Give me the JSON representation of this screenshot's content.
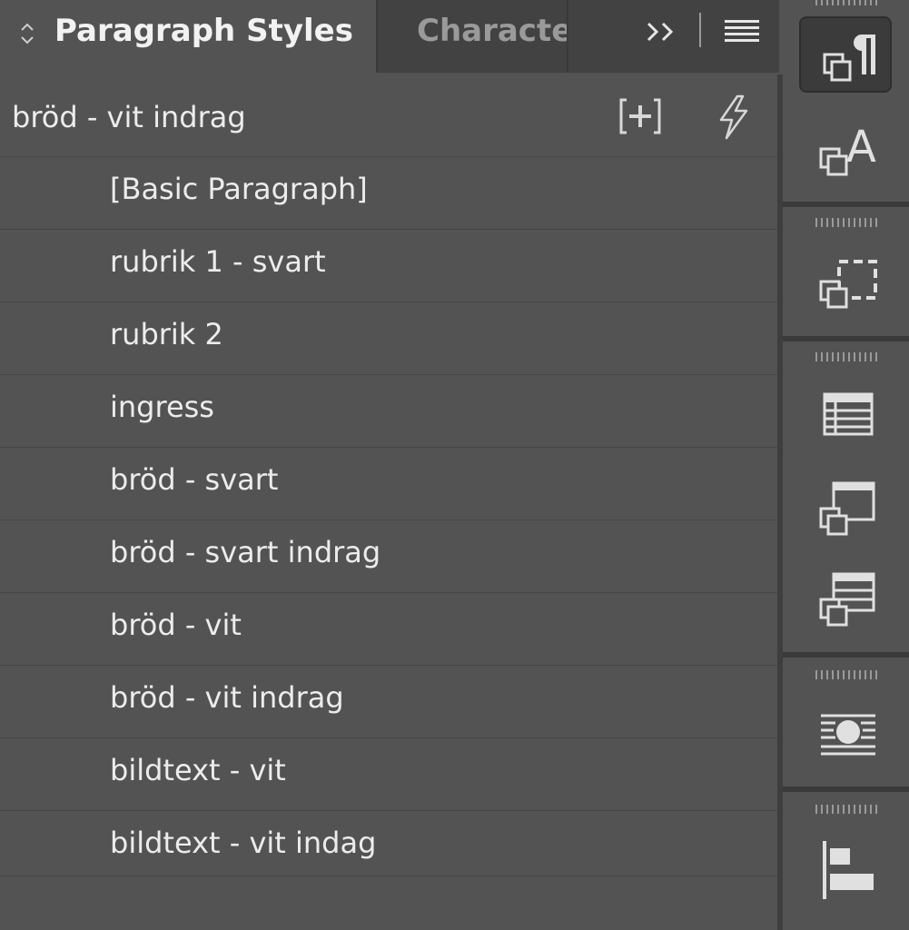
{
  "panel": {
    "tabs": [
      {
        "label": "Paragraph Styles",
        "active": true
      },
      {
        "label": "Characte",
        "active": false
      }
    ],
    "current_style": "bröd - vit indrag",
    "styles": [
      "[Basic Paragraph]",
      "rubrik 1 - svart",
      "rubrik 2",
      "ingress",
      "bröd - svart",
      "bröd - svart indrag",
      "bröd - vit",
      "bröd - vit indrag",
      "bildtext - vit",
      "bildtext - vit indag"
    ]
  },
  "icons": {
    "tab_sort": "up-down-arrows-icon",
    "expand": "double-chevron-right-icon",
    "menu": "hamburger-menu-icon",
    "new_group": "new-style-group-icon",
    "quick_apply": "lightning-bolt-icon",
    "dock": [
      "paragraph-styles-icon",
      "character-styles-icon",
      "object-styles-icon",
      "table-icon",
      "table-styles-icon",
      "cell-styles-icon",
      "text-wrap-icon",
      "align-icon"
    ]
  },
  "colors": {
    "panel_bg": "#535353",
    "tab_bar_bg": "#393939",
    "text": "#ececec",
    "inactive_tab_text": "#9a9a9a"
  }
}
